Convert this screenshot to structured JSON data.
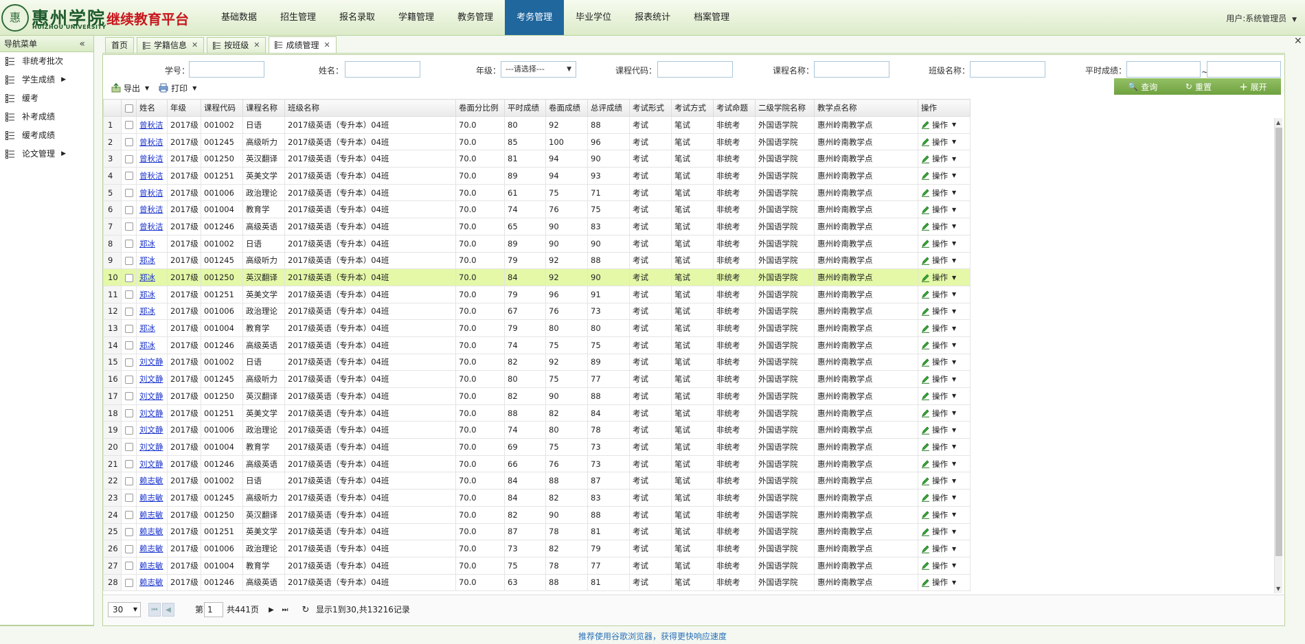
{
  "header": {
    "logo_glyph": "惠",
    "school_name": "惠州学院",
    "school_en": "HUIZHOU UNIVERSITY",
    "platform": "继续教育平台",
    "nav": [
      {
        "label": "基础数据",
        "active": false
      },
      {
        "label": "招生管理",
        "active": false
      },
      {
        "label": "报名录取",
        "active": false
      },
      {
        "label": "学籍管理",
        "active": false
      },
      {
        "label": "教务管理",
        "active": false
      },
      {
        "label": "考务管理",
        "active": true
      },
      {
        "label": "毕业学位",
        "active": false
      },
      {
        "label": "报表统计",
        "active": false
      },
      {
        "label": "档案管理",
        "active": false
      }
    ],
    "user_label": "用户:",
    "user_name": "系统管理员"
  },
  "sidebar": {
    "title": "导航菜单",
    "collapse_glyph": "«",
    "items": [
      {
        "label": "非统考批次",
        "has_sub": false
      },
      {
        "label": "学生成绩",
        "has_sub": true
      },
      {
        "label": "缓考",
        "has_sub": false
      },
      {
        "label": "补考成绩",
        "has_sub": false
      },
      {
        "label": "缓考成绩",
        "has_sub": false
      },
      {
        "label": "论文管理",
        "has_sub": true
      }
    ]
  },
  "tabs": [
    {
      "label": "首页",
      "closable": false,
      "icon": false,
      "active": false
    },
    {
      "label": "学籍信息",
      "closable": true,
      "icon": true,
      "active": false
    },
    {
      "label": "按班级",
      "closable": true,
      "icon": true,
      "active": false
    },
    {
      "label": "成绩管理",
      "closable": true,
      "icon": true,
      "active": true
    }
  ],
  "search": {
    "student_no": "学号：",
    "name": "姓名：",
    "grade": "年级：",
    "grade_select": "---请选择---",
    "course_code": "课程代码：",
    "course_name": "课程名称：",
    "class_name": "班级名称：",
    "usual_score": "平时成绩：",
    "range_sep": "~"
  },
  "toolbar": {
    "export": "导出",
    "print": "打印"
  },
  "buttons": {
    "query": "查询",
    "reset": "重置",
    "expand": "展开"
  },
  "table": {
    "headers": [
      "姓名",
      "年级",
      "课程代码",
      "课程名称",
      "班级名称",
      "卷面分比例",
      "平时成绩",
      "卷面成绩",
      "总评成绩",
      "考试形式",
      "考试方式",
      "考试命题",
      "二级学院名称",
      "教学点名称",
      "操作"
    ],
    "op_label": "操作",
    "common": {
      "grade": "2017级",
      "class": "2017级英语（专升本）04班",
      "ratio": "70.0",
      "form": "考试",
      "mode": "笔试",
      "prop": "非统考",
      "college": "外国语学院",
      "point": "惠州岭南教学点"
    },
    "highlight_row": 10,
    "rows": [
      {
        "n": "1",
        "name": "曾秋洁",
        "code": "001002",
        "course": "日语",
        "usual": "80",
        "paper": "92",
        "total": "88"
      },
      {
        "n": "2",
        "name": "曾秋洁",
        "code": "001245",
        "course": "高级听力",
        "usual": "85",
        "paper": "100",
        "total": "96"
      },
      {
        "n": "3",
        "name": "曾秋洁",
        "code": "001250",
        "course": "英汉翻译",
        "usual": "81",
        "paper": "94",
        "total": "90"
      },
      {
        "n": "4",
        "name": "曾秋洁",
        "code": "001251",
        "course": "英美文学",
        "usual": "89",
        "paper": "94",
        "total": "93"
      },
      {
        "n": "5",
        "name": "曾秋洁",
        "code": "001006",
        "course": "政治理论",
        "usual": "61",
        "paper": "75",
        "total": "71"
      },
      {
        "n": "6",
        "name": "曾秋洁",
        "code": "001004",
        "course": "教育学",
        "usual": "74",
        "paper": "76",
        "total": "75"
      },
      {
        "n": "7",
        "name": "曾秋洁",
        "code": "001246",
        "course": "高级英语",
        "usual": "65",
        "paper": "90",
        "total": "83"
      },
      {
        "n": "8",
        "name": "郑冰",
        "code": "001002",
        "course": "日语",
        "usual": "89",
        "paper": "90",
        "total": "90"
      },
      {
        "n": "9",
        "name": "郑冰",
        "code": "001245",
        "course": "高级听力",
        "usual": "79",
        "paper": "92",
        "total": "88"
      },
      {
        "n": "10",
        "name": "郑冰",
        "code": "001250",
        "course": "英汉翻译",
        "usual": "84",
        "paper": "92",
        "total": "90"
      },
      {
        "n": "11",
        "name": "郑冰",
        "code": "001251",
        "course": "英美文学",
        "usual": "79",
        "paper": "96",
        "total": "91"
      },
      {
        "n": "12",
        "name": "郑冰",
        "code": "001006",
        "course": "政治理论",
        "usual": "67",
        "paper": "76",
        "total": "73"
      },
      {
        "n": "13",
        "name": "郑冰",
        "code": "001004",
        "course": "教育学",
        "usual": "79",
        "paper": "80",
        "total": "80"
      },
      {
        "n": "14",
        "name": "郑冰",
        "code": "001246",
        "course": "高级英语",
        "usual": "74",
        "paper": "75",
        "total": "75"
      },
      {
        "n": "15",
        "name": "刘文静",
        "code": "001002",
        "course": "日语",
        "usual": "82",
        "paper": "92",
        "total": "89"
      },
      {
        "n": "16",
        "name": "刘文静",
        "code": "001245",
        "course": "高级听力",
        "usual": "80",
        "paper": "75",
        "total": "77"
      },
      {
        "n": "17",
        "name": "刘文静",
        "code": "001250",
        "course": "英汉翻译",
        "usual": "82",
        "paper": "90",
        "total": "88"
      },
      {
        "n": "18",
        "name": "刘文静",
        "code": "001251",
        "course": "英美文学",
        "usual": "88",
        "paper": "82",
        "total": "84"
      },
      {
        "n": "19",
        "name": "刘文静",
        "code": "001006",
        "course": "政治理论",
        "usual": "74",
        "paper": "80",
        "total": "78"
      },
      {
        "n": "20",
        "name": "刘文静",
        "code": "001004",
        "course": "教育学",
        "usual": "69",
        "paper": "75",
        "total": "73"
      },
      {
        "n": "21",
        "name": "刘文静",
        "code": "001246",
        "course": "高级英语",
        "usual": "66",
        "paper": "76",
        "total": "73"
      },
      {
        "n": "22",
        "name": "赖志敏",
        "code": "001002",
        "course": "日语",
        "usual": "84",
        "paper": "88",
        "total": "87"
      },
      {
        "n": "23",
        "name": "赖志敏",
        "code": "001245",
        "course": "高级听力",
        "usual": "84",
        "paper": "82",
        "total": "83"
      },
      {
        "n": "24",
        "name": "赖志敏",
        "code": "001250",
        "course": "英汉翻译",
        "usual": "82",
        "paper": "90",
        "total": "88"
      },
      {
        "n": "25",
        "name": "赖志敏",
        "code": "001251",
        "course": "英美文学",
        "usual": "87",
        "paper": "78",
        "total": "81"
      },
      {
        "n": "26",
        "name": "赖志敏",
        "code": "001006",
        "course": "政治理论",
        "usual": "73",
        "paper": "82",
        "total": "79"
      },
      {
        "n": "27",
        "name": "赖志敏",
        "code": "001004",
        "course": "教育学",
        "usual": "75",
        "paper": "78",
        "total": "77"
      },
      {
        "n": "28",
        "name": "赖志敏",
        "code": "001246",
        "course": "高级英语",
        "usual": "63",
        "paper": "88",
        "total": "81"
      }
    ]
  },
  "pager": {
    "page_size": "30",
    "page_prefix": "第",
    "page_value": "1",
    "page_suffix": "共441页",
    "info": "显示1到30,共13216记录"
  },
  "footer": "推荐使用谷歌浏览器，获得更快响应速度",
  "colors": {
    "nav_active": "#20679e",
    "platform": "#c8171e",
    "highlight": "#e4f8a8",
    "button_green": "#7fb04e"
  }
}
